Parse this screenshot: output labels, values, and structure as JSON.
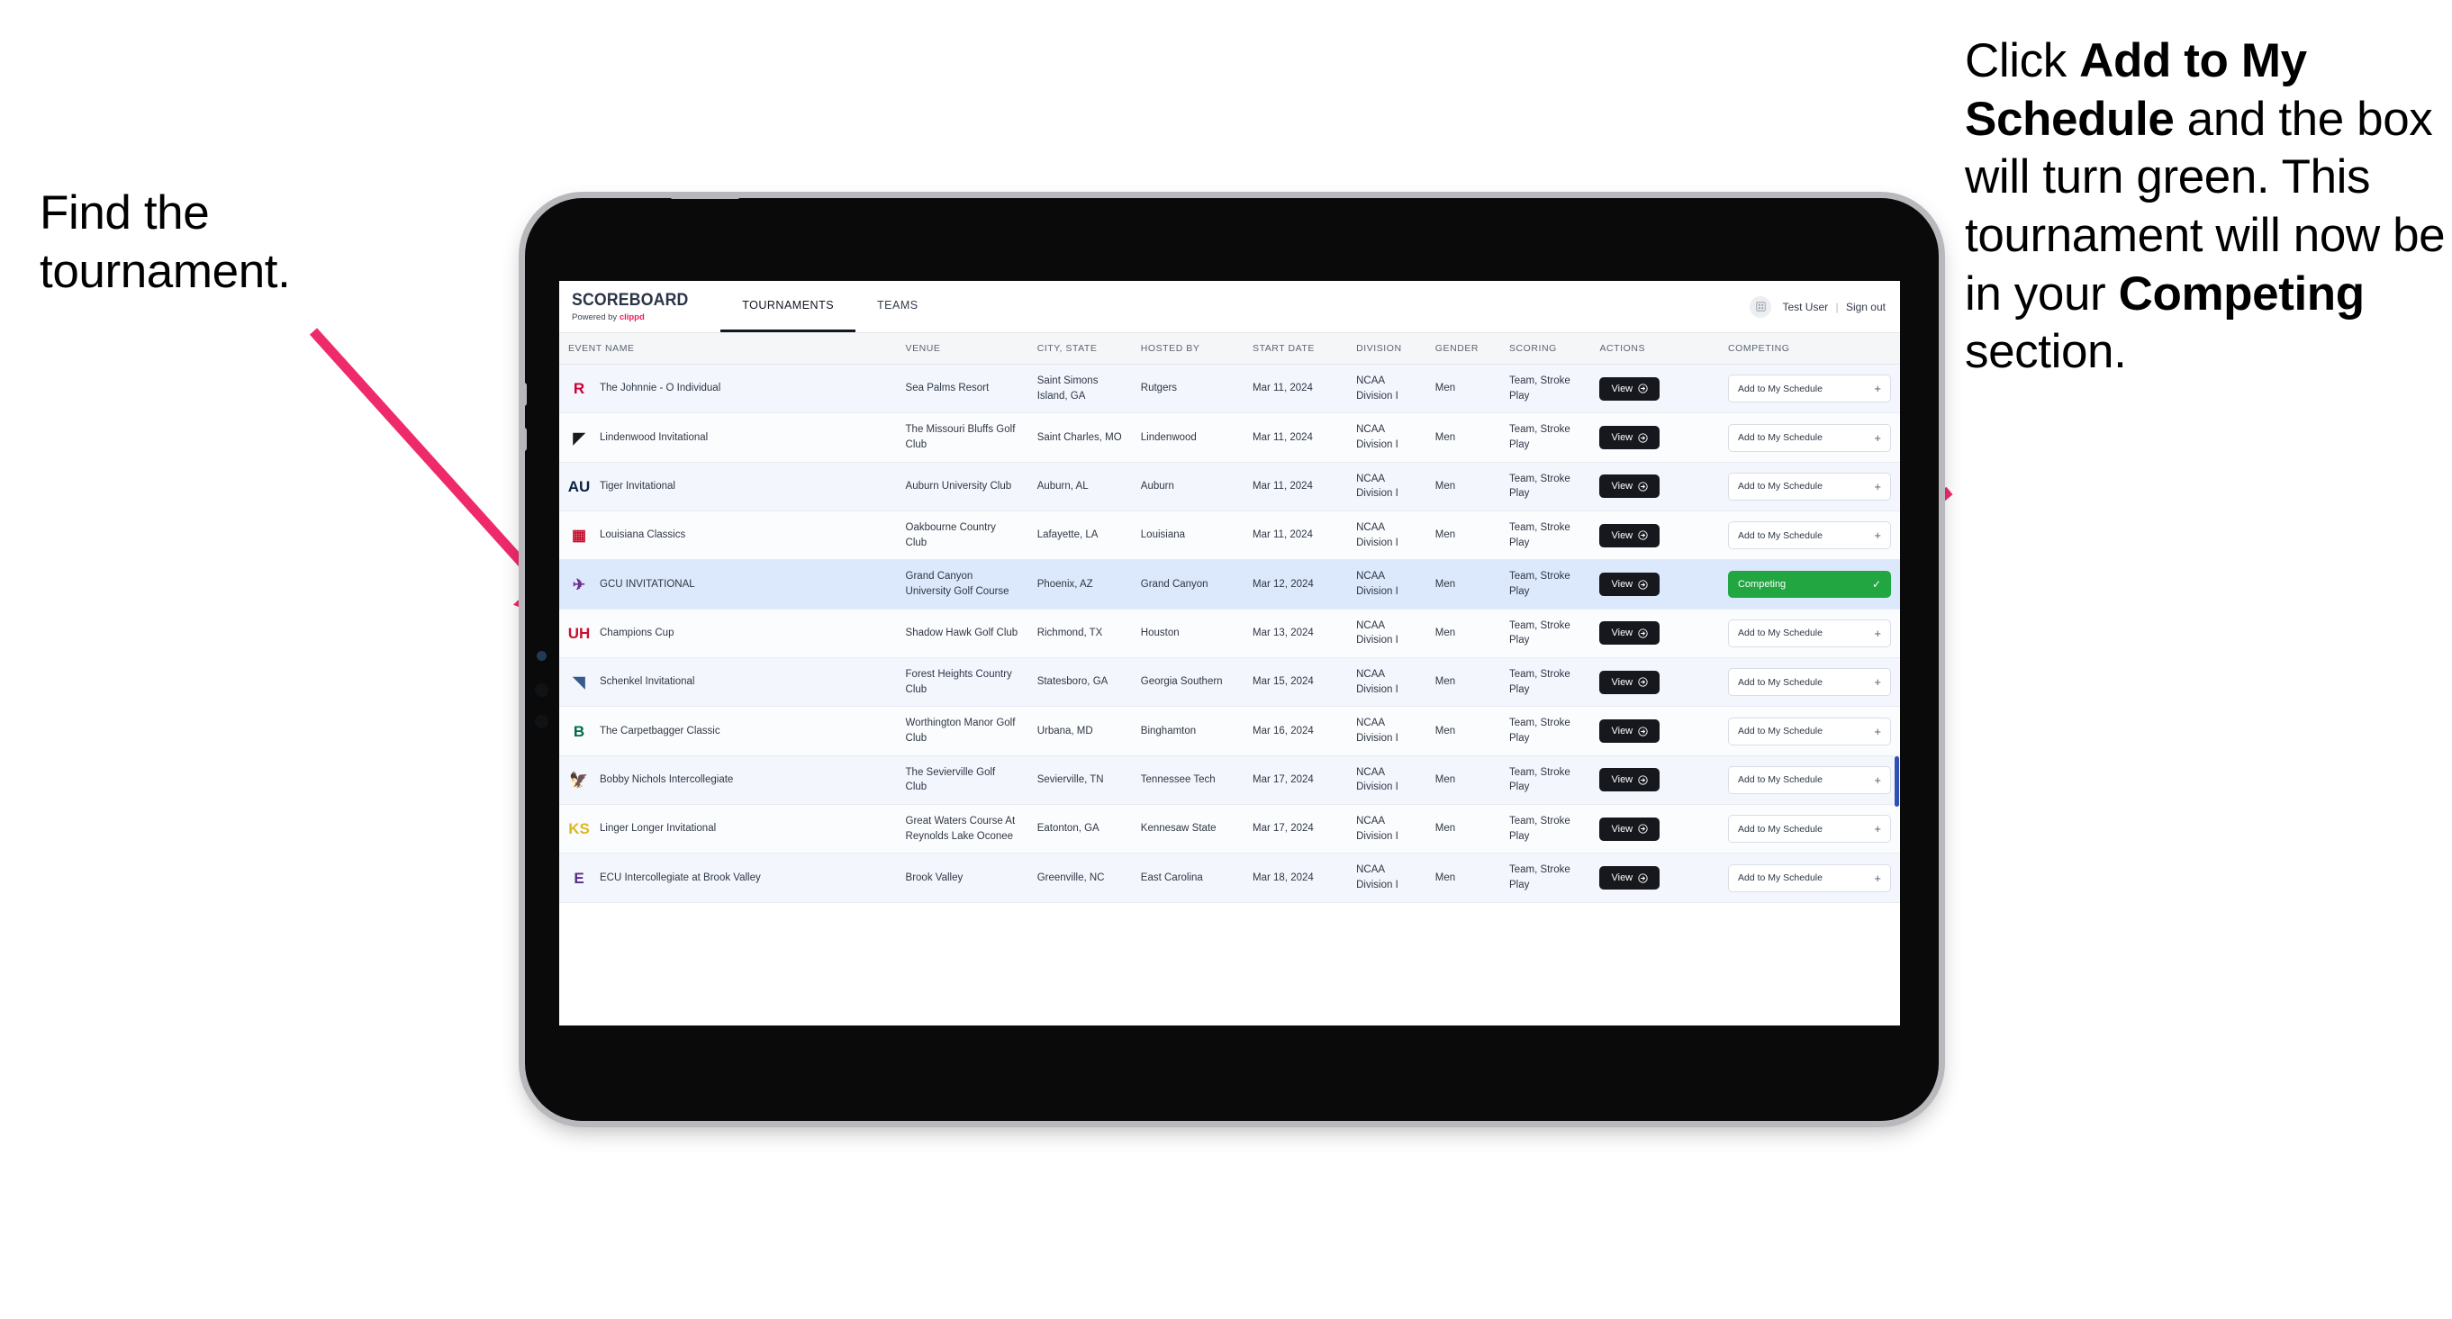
{
  "annotations": {
    "left": "Find the tournament.",
    "right_parts": [
      {
        "text": "Click ",
        "bold": false
      },
      {
        "text": "Add to My Schedule",
        "bold": true
      },
      {
        "text": " and the box will turn green. This tournament will now be in your ",
        "bold": false
      },
      {
        "text": "Competing",
        "bold": true
      },
      {
        "text": " section.",
        "bold": false
      }
    ],
    "arrow_color": "#ee2a6b"
  },
  "app": {
    "brand": {
      "title": "SCOREBOARD",
      "powered_prefix": "Powered by ",
      "powered_name": "clippd",
      "powered_color": "#ec1a5a"
    },
    "nav": {
      "tabs": [
        {
          "label": "TOURNAMENTS",
          "active": true
        },
        {
          "label": "TEAMS",
          "active": false
        }
      ]
    },
    "user": {
      "avatar_icon": "user-grid-icon",
      "name": "Test User",
      "separator": "|",
      "sign_out": "Sign out"
    },
    "table": {
      "columns": [
        "EVENT NAME",
        "VENUE",
        "CITY, STATE",
        "HOSTED BY",
        "START DATE",
        "DIVISION",
        "GENDER",
        "SCORING",
        "ACTIONS",
        "COMPETING"
      ],
      "action_label": "View",
      "add_label": "Add to My Schedule",
      "add_plus": "+",
      "competing_label": "Competing",
      "competing_check": "✓",
      "competing_color": "#22a641",
      "rows": [
        {
          "logo": {
            "glyph": "R",
            "color": "#cc0033",
            "bg": "transparent"
          },
          "event": "The Johnnie - O Individual",
          "venue": "Sea Palms Resort",
          "city": "Saint Simons Island, GA",
          "host": "Rutgers",
          "date": "Mar 11, 2024",
          "division": "NCAA Division I",
          "gender": "Men",
          "scoring": "Team, Stroke Play",
          "competing": false,
          "selected": false
        },
        {
          "logo": {
            "glyph": "◤",
            "color": "#1a1a1a",
            "bg": "transparent"
          },
          "event": "Lindenwood Invitational",
          "venue": "The Missouri Bluffs Golf Club",
          "city": "Saint Charles, MO",
          "host": "Lindenwood",
          "date": "Mar 11, 2024",
          "division": "NCAA Division I",
          "gender": "Men",
          "scoring": "Team, Stroke Play",
          "competing": false,
          "selected": false
        },
        {
          "logo": {
            "glyph": "AU",
            "color": "#0c2340",
            "bg": "transparent"
          },
          "event": "Tiger Invitational",
          "venue": "Auburn University Club",
          "city": "Auburn, AL",
          "host": "Auburn",
          "date": "Mar 11, 2024",
          "division": "NCAA Division I",
          "gender": "Men",
          "scoring": "Team, Stroke Play",
          "competing": false,
          "selected": false
        },
        {
          "logo": {
            "glyph": "▦",
            "color": "#c8102e",
            "bg": "transparent"
          },
          "event": "Louisiana Classics",
          "venue": "Oakbourne Country Club",
          "city": "Lafayette, LA",
          "host": "Louisiana",
          "date": "Mar 11, 2024",
          "division": "NCAA Division I",
          "gender": "Men",
          "scoring": "Team, Stroke Play",
          "competing": false,
          "selected": false
        },
        {
          "logo": {
            "glyph": "✈",
            "color": "#6c2c8f",
            "bg": "transparent"
          },
          "event": "GCU INVITATIONAL",
          "venue": "Grand Canyon University Golf Course",
          "city": "Phoenix, AZ",
          "host": "Grand Canyon",
          "date": "Mar 12, 2024",
          "division": "NCAA Division I",
          "gender": "Men",
          "scoring": "Team, Stroke Play",
          "competing": true,
          "selected": true
        },
        {
          "logo": {
            "glyph": "UH",
            "color": "#c8102e",
            "bg": "transparent"
          },
          "event": "Champions Cup",
          "venue": "Shadow Hawk Golf Club",
          "city": "Richmond, TX",
          "host": "Houston",
          "date": "Mar 13, 2024",
          "division": "NCAA Division I",
          "gender": "Men",
          "scoring": "Team, Stroke Play",
          "competing": false,
          "selected": false
        },
        {
          "logo": {
            "glyph": "◥",
            "color": "#365a8c",
            "bg": "transparent"
          },
          "event": "Schenkel Invitational",
          "venue": "Forest Heights Country Club",
          "city": "Statesboro, GA",
          "host": "Georgia Southern",
          "date": "Mar 15, 2024",
          "division": "NCAA Division I",
          "gender": "Men",
          "scoring": "Team, Stroke Play",
          "competing": false,
          "selected": false
        },
        {
          "logo": {
            "glyph": "B",
            "color": "#006a4d",
            "bg": "transparent"
          },
          "event": "The Carpetbagger Classic",
          "venue": "Worthington Manor Golf Club",
          "city": "Urbana, MD",
          "host": "Binghamton",
          "date": "Mar 16, 2024",
          "division": "NCAA Division I",
          "gender": "Men",
          "scoring": "Team, Stroke Play",
          "competing": false,
          "selected": false
        },
        {
          "logo": {
            "glyph": "🦅",
            "color": "#54227d",
            "bg": "transparent"
          },
          "event": "Bobby Nichols Intercollegiate",
          "venue": "The Sevierville Golf Club",
          "city": "Sevierville, TN",
          "host": "Tennessee Tech",
          "date": "Mar 17, 2024",
          "division": "NCAA Division I",
          "gender": "Men",
          "scoring": "Team, Stroke Play",
          "competing": false,
          "selected": false
        },
        {
          "logo": {
            "glyph": "KS",
            "color": "#ddb81d",
            "bg": "transparent"
          },
          "event": "Linger Longer Invitational",
          "venue": "Great Waters Course At Reynolds Lake Oconee",
          "city": "Eatonton, GA",
          "host": "Kennesaw State",
          "date": "Mar 17, 2024",
          "division": "NCAA Division I",
          "gender": "Men",
          "scoring": "Team, Stroke Play",
          "competing": false,
          "selected": false
        },
        {
          "logo": {
            "glyph": "E",
            "color": "#592a8a",
            "bg": "transparent"
          },
          "event": "ECU Intercollegiate at Brook Valley",
          "venue": "Brook Valley",
          "city": "Greenville, NC",
          "host": "East Carolina",
          "date": "Mar 18, 2024",
          "division": "NCAA Division I",
          "gender": "Men",
          "scoring": "Team, Stroke Play",
          "competing": false,
          "selected": false,
          "clipped": true
        }
      ]
    }
  }
}
